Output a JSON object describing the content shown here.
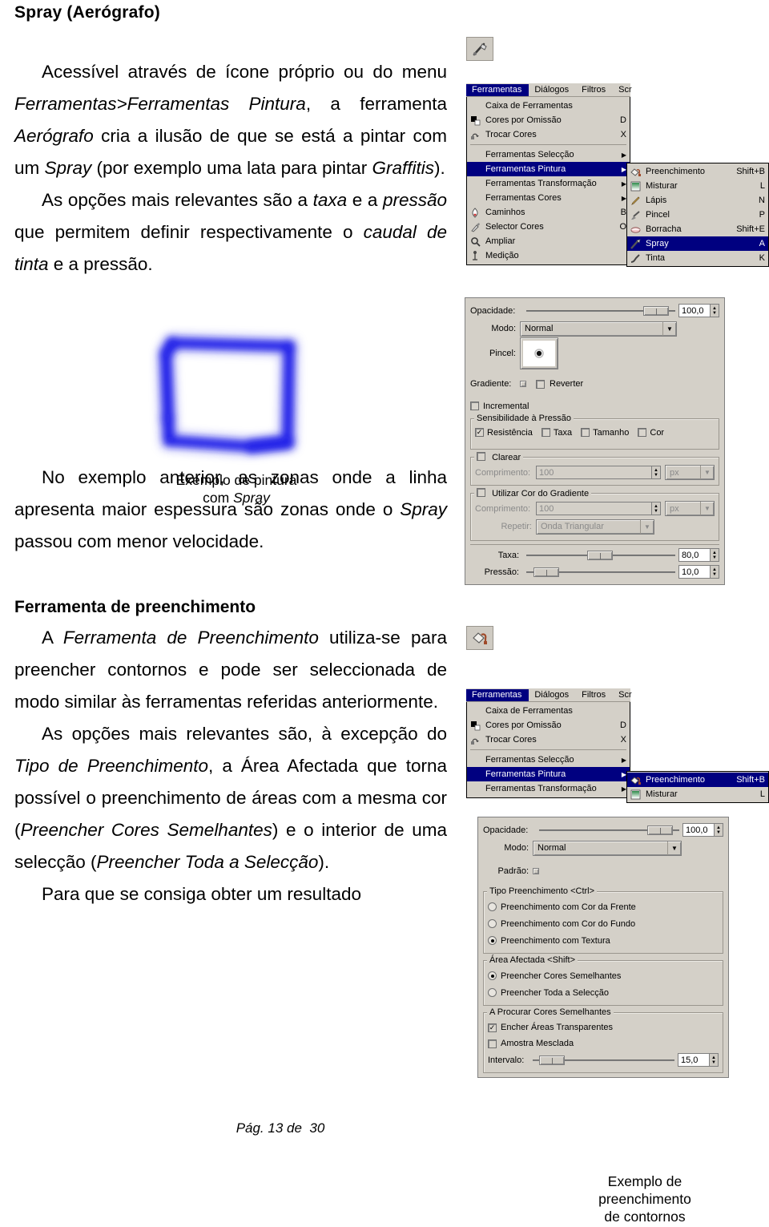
{
  "document": {
    "title": "Spray (Aerógrafo)",
    "footer_prefix": "Pág. 13 de",
    "footer_page_total": "30"
  },
  "body_text": {
    "p1_part1": "Acessível através de ícone próprio ou do menu ",
    "p1_em1": "Ferramentas>Ferramentas Pintura",
    "p1_part2": ", a ferramenta ",
    "p1_em2": "Aerógrafo",
    "p1_part3": " cria a ilusão de que se está a pintar com um ",
    "p1_em3": "Spray",
    "p1_part4": " (por exemplo uma lata para pintar ",
    "p1_em4": "Graffitis",
    "p1_part5": ").",
    "p2_part1": "As opções mais relevantes são a ",
    "p2_em1": "taxa",
    "p2_part2": " e a ",
    "p2_em2": "pressão",
    "p2_part3": " que permitem definir respectivamente o ",
    "p2_em3": "caudal de tinta",
    "p2_part4": " e a pressão.",
    "p3_part1": "No exemplo anterior, as zonas onde a linha apresenta maior espessura são zonas onde o ",
    "p3_em1": "Spray",
    "p3_part2": " passou com menor velocidade.",
    "section2_heading": "Ferramenta de preenchimento",
    "p4_part1": "A ",
    "p4_em1": "Ferramenta de Preenchimento",
    "p4_part2": " utiliza-se para preencher contornos e pode ser seleccionada de modo similar às ferramentas referidas anteriormente.",
    "p5_part1": "As opções mais relevantes são, à excepção do ",
    "p5_em1": "Tipo de Preenchimento",
    "p5_part2": ", a Área Afectada que torna possível o preenchimento de áreas com a mesma cor (",
    "p5_em2": "Preencher Cores Semelhantes",
    "p5_part3": ") e o interior de uma selecção (",
    "p5_em3": "Preencher Toda a Selecção",
    "p5_part4": ").",
    "p6": "Para que se consiga obter um resultado"
  },
  "captions": {
    "spray_line1": "Exemplo de pintura",
    "spray_line2_prefix": "com ",
    "spray_line2_em": "Spray",
    "fill_line1": "Exemplo de",
    "fill_line2": "preenchimento",
    "fill_line3": "de contornos"
  },
  "spray_artwork": {
    "stroke_color": "#2020e8",
    "description": "blurred blue spray-painted rectangle outline"
  },
  "gimp_menu_spray": {
    "menubar": [
      {
        "label": "Ferramentas",
        "selected": true
      },
      {
        "label": "Diálogos",
        "selected": false
      },
      {
        "label": "Filtros",
        "selected": false
      },
      {
        "label": "Scr",
        "selected": false
      }
    ],
    "items": [
      {
        "label": "Caixa de Ferramentas",
        "shortcut": "",
        "icon": "",
        "arrow": false,
        "highlight": false
      },
      {
        "label": "Cores por Omissão",
        "shortcut": "D",
        "icon": "default-colors-icon",
        "arrow": false,
        "highlight": false
      },
      {
        "label": "Trocar Cores",
        "shortcut": "X",
        "icon": "swap-colors-icon",
        "arrow": false,
        "highlight": false
      },
      {
        "separator": true
      },
      {
        "label": "Ferramentas Selecção",
        "shortcut": "",
        "icon": "",
        "arrow": true,
        "highlight": false
      },
      {
        "label": "Ferramentas Pintura",
        "shortcut": "",
        "icon": "",
        "arrow": true,
        "highlight": true
      },
      {
        "label": "Ferramentas Transformação",
        "shortcut": "",
        "icon": "",
        "arrow": true,
        "highlight": false
      },
      {
        "label": "Ferramentas Cores",
        "shortcut": "",
        "icon": "",
        "arrow": true,
        "highlight": false
      },
      {
        "label": "Caminhos",
        "shortcut": "B",
        "icon": "paths-icon",
        "arrow": false,
        "highlight": false
      },
      {
        "label": "Selector Cores",
        "shortcut": "O",
        "icon": "color-picker-icon",
        "arrow": false,
        "highlight": false
      },
      {
        "label": "Ampliar",
        "shortcut": "",
        "icon": "zoom-icon",
        "arrow": false,
        "highlight": false
      },
      {
        "label": "Medição",
        "shortcut": "",
        "icon": "measure-icon",
        "arrow": false,
        "highlight": false
      }
    ],
    "submenu": [
      {
        "label": "Preenchimento",
        "shortcut": "Shift+B",
        "icon": "bucket-fill-icon",
        "highlight": false
      },
      {
        "label": "Misturar",
        "shortcut": "L",
        "icon": "blend-icon",
        "highlight": false
      },
      {
        "label": "Lápis",
        "shortcut": "N",
        "icon": "pencil-icon",
        "highlight": false
      },
      {
        "label": "Pincel",
        "shortcut": "P",
        "icon": "paintbrush-icon",
        "highlight": false
      },
      {
        "label": "Borracha",
        "shortcut": "Shift+E",
        "icon": "eraser-icon",
        "highlight": false
      },
      {
        "label": "Spray",
        "shortcut": "A",
        "icon": "airbrush-icon",
        "highlight": true
      },
      {
        "label": "Tinta",
        "shortcut": "K",
        "icon": "ink-icon",
        "highlight": false
      }
    ]
  },
  "gimp_menu_fill": {
    "menubar": [
      {
        "label": "Ferramentas",
        "selected": true
      },
      {
        "label": "Diálogos",
        "selected": false
      },
      {
        "label": "Filtros",
        "selected": false
      },
      {
        "label": "Scr",
        "selected": false
      }
    ],
    "items": [
      {
        "label": "Caixa de Ferramentas",
        "shortcut": "",
        "icon": "",
        "arrow": false,
        "highlight": false
      },
      {
        "label": "Cores por Omissão",
        "shortcut": "D",
        "icon": "default-colors-icon",
        "arrow": false,
        "highlight": false
      },
      {
        "label": "Trocar Cores",
        "shortcut": "X",
        "icon": "swap-colors-icon",
        "arrow": false,
        "highlight": false
      },
      {
        "separator": true
      },
      {
        "label": "Ferramentas Selecção",
        "shortcut": "",
        "icon": "",
        "arrow": true,
        "highlight": false
      },
      {
        "label": "Ferramentas Pintura",
        "shortcut": "",
        "icon": "",
        "arrow": true,
        "highlight": true
      },
      {
        "label": "Ferramentas Transformação",
        "shortcut": "",
        "icon": "",
        "arrow": true,
        "highlight": false
      }
    ],
    "submenu": [
      {
        "label": "Preenchimento",
        "shortcut": "Shift+B",
        "icon": "bucket-fill-icon",
        "highlight": true
      },
      {
        "label": "Misturar",
        "shortcut": "L",
        "icon": "blend-icon",
        "highlight": false
      }
    ]
  },
  "spray_options": {
    "opacity_label": "Opacidade:",
    "opacity_value": "100,0",
    "mode_label": "Modo:",
    "mode_value": "Normal",
    "brush_label": "Pincel:",
    "gradient_label": "Gradiente:",
    "reverse_label": "Reverter",
    "reverse_checked": false,
    "incremental_label": "Incremental",
    "incremental_checked": false,
    "pressure_group_label": "Sensibilidade à Pressão",
    "pressure_options": [
      {
        "label": "Resistência",
        "checked": true
      },
      {
        "label": "Taxa",
        "checked": false
      },
      {
        "label": "Tamanho",
        "checked": false
      },
      {
        "label": "Cor",
        "checked": false
      }
    ],
    "fade_group_label": "Clarear",
    "fade_checked": false,
    "fade_length_label": "Comprimento:",
    "fade_length_value": "100",
    "fade_unit": "px",
    "gradient_group_label": "Utilizar Cor do Gradiente",
    "gradient_group_checked": false,
    "gradient_length_label": "Comprimento:",
    "gradient_length_value": "100",
    "gradient_unit": "px",
    "repeat_label": "Repetir:",
    "repeat_value": "Onda Triangular",
    "rate_label": "Taxa:",
    "rate_value": "80,0",
    "pressure_label": "Pressão:",
    "pressure_value": "10,0"
  },
  "fill_options": {
    "opacity_label": "Opacidade:",
    "opacity_value": "100,0",
    "mode_label": "Modo:",
    "mode_value": "Normal",
    "pattern_label": "Padrão:",
    "fill_type_group_label": "Tipo Preenchimento <Ctrl>",
    "fill_type_options": [
      {
        "label": "Preenchimento com Cor da Frente",
        "selected": false
      },
      {
        "label": "Preenchimento com Cor do Fundo",
        "selected": false
      },
      {
        "label": "Preenchimento com Textura",
        "selected": true
      }
    ],
    "affected_group_label": "Área Afectada  <Shift>",
    "affected_options": [
      {
        "label": "Preencher Cores Semelhantes",
        "selected": true
      },
      {
        "label": "Preencher Toda a Selecção",
        "selected": false
      }
    ],
    "similar_group_label": "A Procurar Cores Semelhantes",
    "fill_transparent_label": "Encher Áreas Transparentes",
    "fill_transparent_checked": true,
    "sample_merged_label": "Amostra Mesclada",
    "sample_merged_checked": false,
    "threshold_label": "Intervalo:",
    "threshold_value": "15,0"
  },
  "tool_icons": {
    "airbrush": "airbrush-tool-icon",
    "bucket": "bucket-fill-tool-icon"
  },
  "colors": {
    "menu_highlight": "#000080",
    "widget_face": "#d4d0c8",
    "spray_blue": "#2020e8"
  }
}
